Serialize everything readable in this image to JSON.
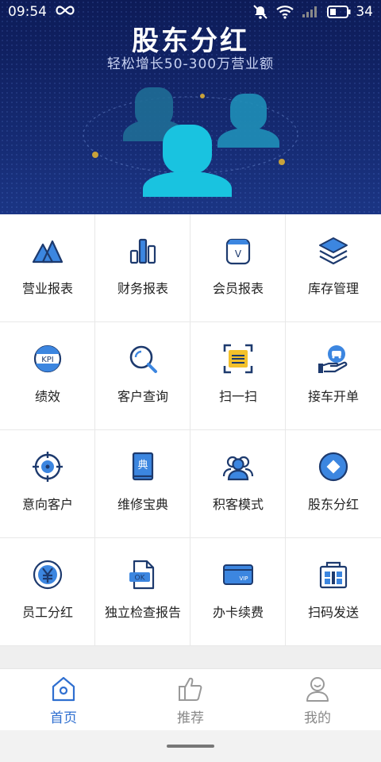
{
  "status_bar": {
    "time": "09:54",
    "battery": "34"
  },
  "banner": {
    "title": "股东分红",
    "subtitle": "轻松增长50-300万营业额"
  },
  "grid": [
    {
      "label": "营业报表",
      "icon": "mountain-icon"
    },
    {
      "label": "财务报表",
      "icon": "bar-chart-icon"
    },
    {
      "label": "会员报表",
      "icon": "member-badge-icon"
    },
    {
      "label": "库存管理",
      "icon": "layers-icon"
    },
    {
      "label": "绩效",
      "icon": "kpi-icon"
    },
    {
      "label": "客户查询",
      "icon": "search-icon"
    },
    {
      "label": "扫一扫",
      "icon": "scan-icon"
    },
    {
      "label": "接车开单",
      "icon": "car-hand-icon"
    },
    {
      "label": "意向客户",
      "icon": "target-icon"
    },
    {
      "label": "维修宝典",
      "icon": "book-icon"
    },
    {
      "label": "积客模式",
      "icon": "users-icon"
    },
    {
      "label": "股东分红",
      "icon": "diamond-icon"
    },
    {
      "label": "员工分红",
      "icon": "yen-coin-icon"
    },
    {
      "label": "独立检查报告",
      "icon": "ok-report-icon"
    },
    {
      "label": "办卡续费",
      "icon": "vip-card-icon"
    },
    {
      "label": "扫码发送",
      "icon": "qr-send-icon"
    }
  ],
  "icon_text": {
    "kpi": "KPI",
    "book": "典",
    "ok": "OK",
    "vip": "VIP",
    "v": "V"
  },
  "tabs": [
    {
      "label": "首页",
      "icon": "home-icon",
      "active": true
    },
    {
      "label": "推荐",
      "icon": "thumbs-up-icon",
      "active": false
    },
    {
      "label": "我的",
      "icon": "person-icon",
      "active": false
    }
  ],
  "colors": {
    "accent": "#2f6fd0",
    "icon_dark": "#1d3a6e",
    "icon_blue": "#3c86e0",
    "banner": "#14286e",
    "figure": "#19c3e0"
  }
}
